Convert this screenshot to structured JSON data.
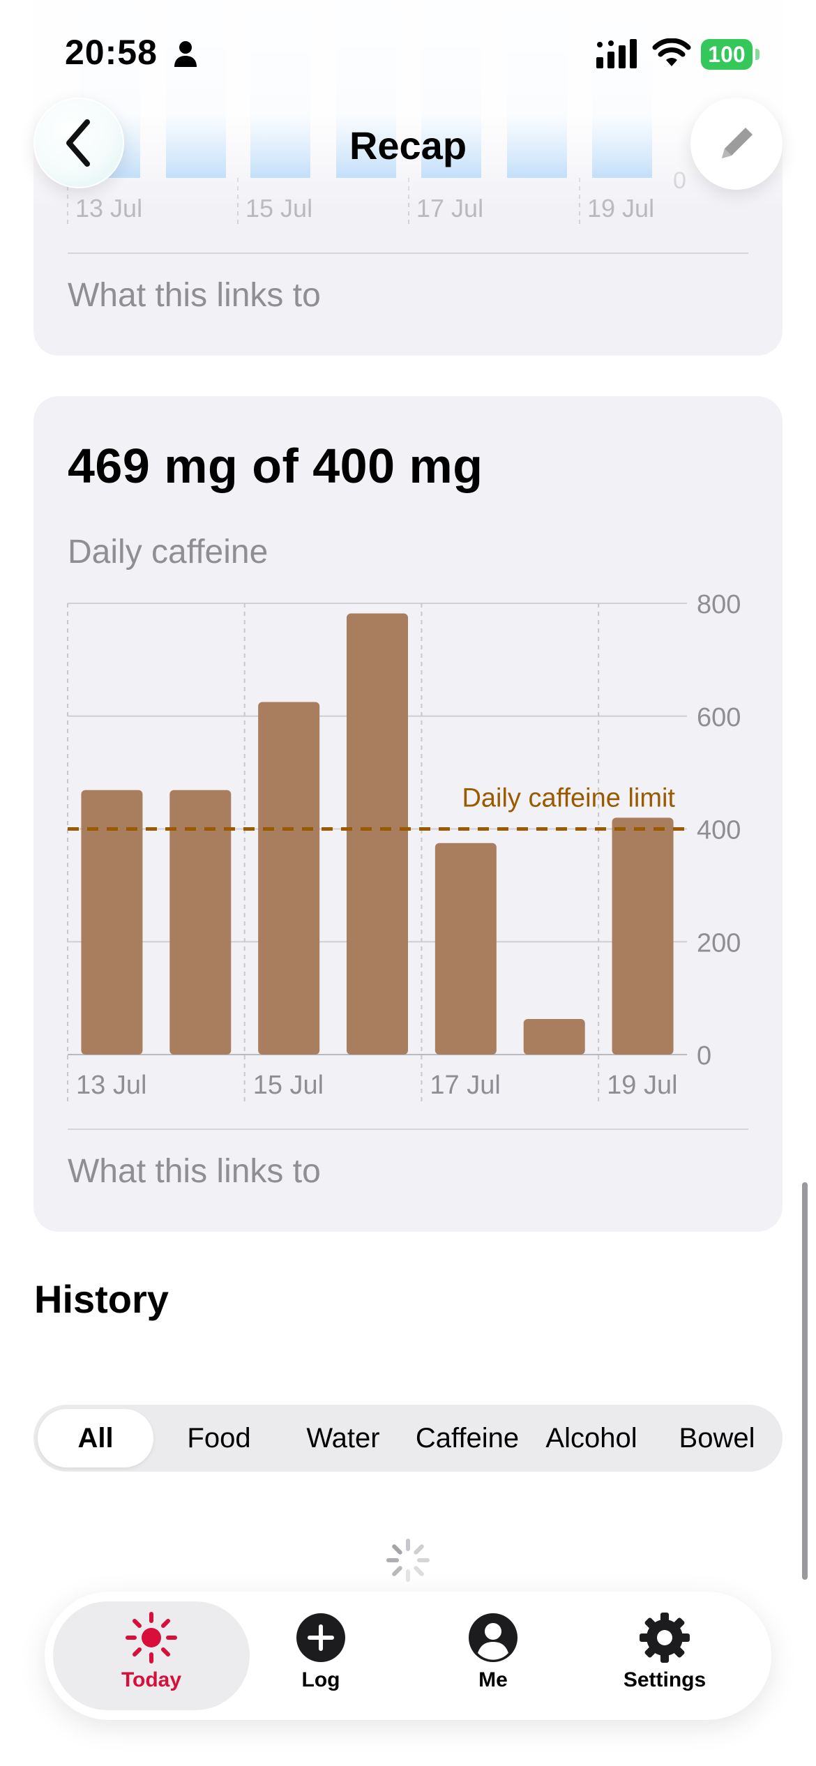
{
  "status_bar": {
    "time": "20:58",
    "battery": "100"
  },
  "nav": {
    "title": "Recap",
    "back_icon": "chevron-left-icon",
    "edit_icon": "pencil-icon"
  },
  "water_card": {
    "x_ticks": [
      "13 Jul",
      "15 Jul",
      "17 Jul",
      "19 Jul"
    ],
    "y_zero": "0",
    "links_label": "What this links to"
  },
  "caffeine_card": {
    "headline": "469 mg of 400 mg",
    "subtitle": "Daily caffeine",
    "links_label": "What this links to"
  },
  "chart_data": {
    "type": "bar",
    "categories": [
      "13 Jul",
      "14 Jul",
      "15 Jul",
      "16 Jul",
      "17 Jul",
      "18 Jul",
      "19 Jul"
    ],
    "values": [
      469,
      469,
      625,
      782,
      375,
      63,
      420
    ],
    "x_tick_labels": [
      "13 Jul",
      "15 Jul",
      "17 Jul",
      "19 Jul"
    ],
    "y_ticks": [
      0,
      200,
      400,
      600,
      800
    ],
    "ylim": [
      0,
      800
    ],
    "limit_line": {
      "value": 400,
      "label": "Daily caffeine limit",
      "color": "#9a5a00"
    },
    "bar_color": "#a97e5f",
    "grid": true
  },
  "history": {
    "title": "History",
    "filters": [
      "All",
      "Food",
      "Water",
      "Caffeine",
      "Alcohol",
      "Bowel"
    ],
    "selected": "All"
  },
  "tabbar": {
    "items": [
      {
        "label": "Today",
        "icon": "sun-icon",
        "active": true
      },
      {
        "label": "Log",
        "icon": "plus-circle-icon",
        "active": false
      },
      {
        "label": "Me",
        "icon": "person-circle-icon",
        "active": false
      },
      {
        "label": "Settings",
        "icon": "gear-icon",
        "active": false
      }
    ]
  },
  "colors": {
    "accent": "#d70f3a",
    "card": "#f2f1f6",
    "muted": "#8e8e93"
  }
}
